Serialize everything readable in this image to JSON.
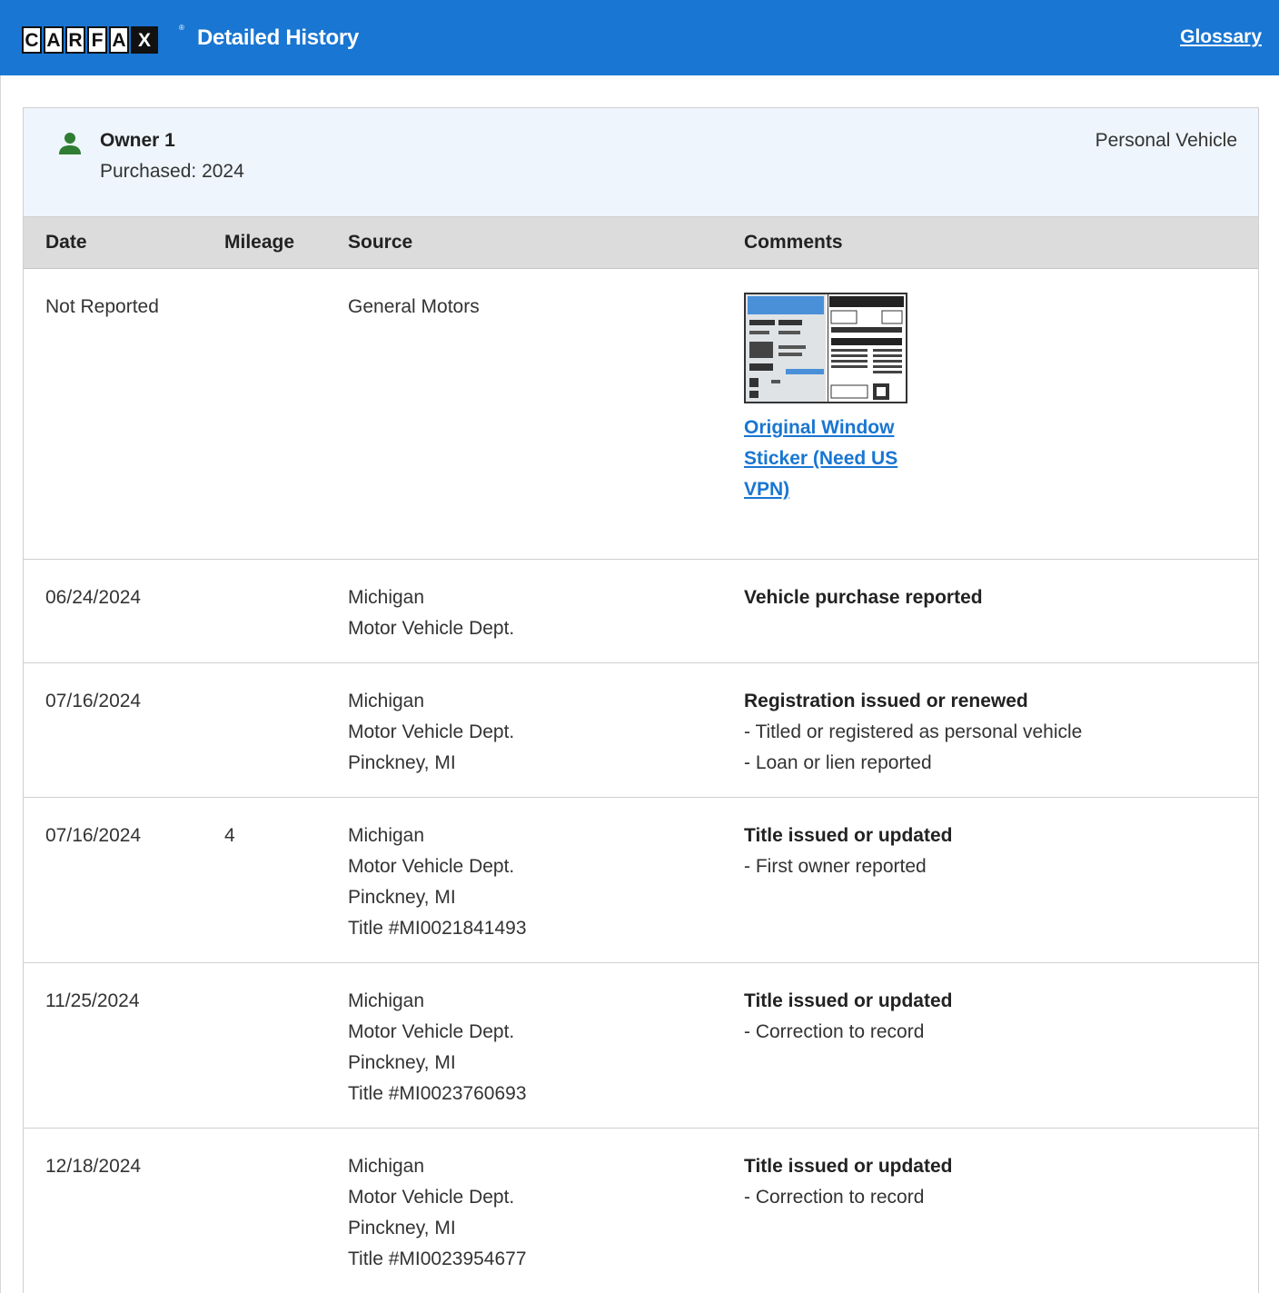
{
  "header": {
    "logo_letters": [
      "C",
      "A",
      "R",
      "F",
      "A",
      "X"
    ],
    "trademark": "®",
    "title": "Detailed History",
    "glossary_label": "Glossary"
  },
  "owner": {
    "name": "Owner 1",
    "purchased": "Purchased: 2024",
    "vehicle_type": "Personal Vehicle",
    "icon": "person-icon",
    "icon_color": "#2e7d32"
  },
  "table": {
    "columns": [
      "Date",
      "Mileage",
      "Source",
      "Comments"
    ],
    "rows": [
      {
        "date": "Not Reported",
        "mileage": "",
        "source": [
          "General Motors"
        ],
        "comment_title": "",
        "comment_notes": [],
        "sticker_link": "Original Window Sticker (Need US VPN)"
      },
      {
        "date": "06/24/2024",
        "mileage": "",
        "source": [
          "Michigan",
          "Motor Vehicle Dept."
        ],
        "comment_title": "Vehicle purchase reported",
        "comment_notes": []
      },
      {
        "date": "07/16/2024",
        "mileage": "",
        "source": [
          "Michigan",
          "Motor Vehicle Dept.",
          "Pinckney, MI"
        ],
        "comment_title": "Registration issued or renewed",
        "comment_notes": [
          "- Titled or registered as personal vehicle",
          "- Loan or lien reported"
        ]
      },
      {
        "date": "07/16/2024",
        "mileage": "4",
        "source": [
          "Michigan",
          "Motor Vehicle Dept.",
          "Pinckney, MI",
          "Title #MI0021841493"
        ],
        "comment_title": "Title issued or updated",
        "comment_notes": [
          "- First owner reported"
        ]
      },
      {
        "date": "11/25/2024",
        "mileage": "",
        "source": [
          "Michigan",
          "Motor Vehicle Dept.",
          "Pinckney, MI",
          "Title #MI0023760693"
        ],
        "comment_title": "Title issued or updated",
        "comment_notes": [
          "- Correction to record"
        ]
      },
      {
        "date": "12/18/2024",
        "mileage": "",
        "source": [
          "Michigan",
          "Motor Vehicle Dept.",
          "Pinckney, MI",
          "Title #MI0023954677"
        ],
        "comment_title": "Title issued or updated",
        "comment_notes": [
          "- Correction to record"
        ]
      }
    ]
  },
  "colors": {
    "header_bg": "#1976d2",
    "owner_bg": "#eef5fc",
    "table_head_bg": "#dcdcdc",
    "link": "#1976d2"
  }
}
